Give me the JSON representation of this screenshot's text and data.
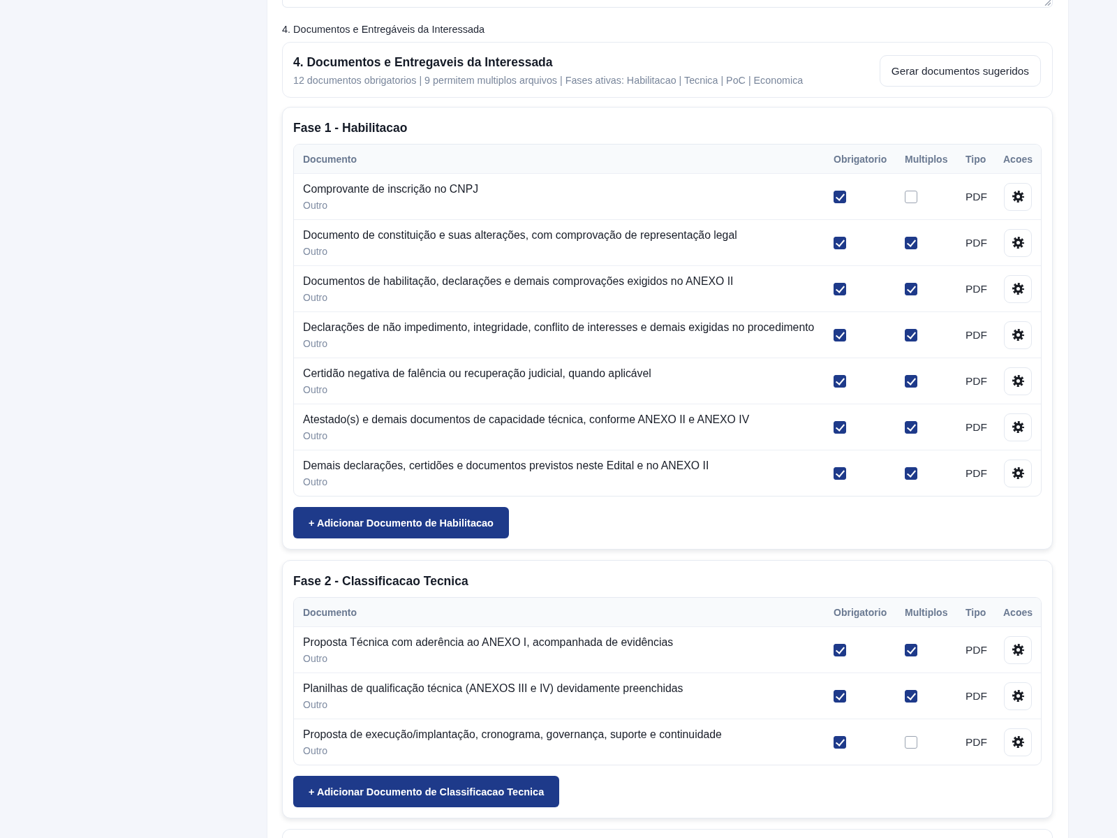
{
  "section_label": "4. Documentos e Entregáveis da Interessada",
  "summary": {
    "title": "4. Documentos e Entregaveis da Interessada",
    "subtitle": "12 documentos obrigatorios | 9 permitem multiplos arquivos | Fases ativas: Habilitacao | Tecnica | PoC | Economica",
    "button": "Gerar documentos sugeridos"
  },
  "phases": [
    {
      "title": "Fase 1 - Habilitacao",
      "columns": [
        "Documento",
        "Obrigatorio",
        "Multiplos",
        "Tipo",
        "Acoes"
      ],
      "rows": [
        {
          "name": "Comprovante de inscrição no CNPJ",
          "category": "Outro",
          "required": true,
          "multiple": false,
          "type": "PDF"
        },
        {
          "name": "Documento de constituição e suas alterações, com comprovação de representação legal",
          "category": "Outro",
          "required": true,
          "multiple": true,
          "type": "PDF"
        },
        {
          "name": "Documentos de habilitação, declarações e demais comprovações exigidos no ANEXO II",
          "category": "Outro",
          "required": true,
          "multiple": true,
          "type": "PDF"
        },
        {
          "name": "Declarações de não impedimento, integridade, conflito de interesses e demais exigidas no procedimento",
          "category": "Outro",
          "required": true,
          "multiple": true,
          "type": "PDF"
        },
        {
          "name": "Certidão negativa de falência ou recuperação judicial, quando aplicável",
          "category": "Outro",
          "required": true,
          "multiple": true,
          "type": "PDF"
        },
        {
          "name": "Atestado(s) e demais documentos de capacidade técnica, conforme ANEXO II e ANEXO IV",
          "category": "Outro",
          "required": true,
          "multiple": true,
          "type": "PDF"
        },
        {
          "name": "Demais declarações, certidões e documentos previstos neste Edital e no ANEXO II",
          "category": "Outro",
          "required": true,
          "multiple": true,
          "type": "PDF"
        }
      ],
      "add_button": "+ Adicionar Documento de Habilitacao"
    },
    {
      "title": "Fase 2 - Classificacao Tecnica",
      "columns": [
        "Documento",
        "Obrigatorio",
        "Multiplos",
        "Tipo",
        "Acoes"
      ],
      "rows": [
        {
          "name": "Proposta Técnica com aderência ao ANEXO I, acompanhada de evidências",
          "category": "Outro",
          "required": true,
          "multiple": true,
          "type": "PDF"
        },
        {
          "name": "Planilhas de qualificação técnica (ANEXOS III e IV) devidamente preenchidas",
          "category": "Outro",
          "required": true,
          "multiple": true,
          "type": "PDF"
        },
        {
          "name": "Proposta de execução/implantação, cronograma, governança, suporte e continuidade",
          "category": "Outro",
          "required": true,
          "multiple": false,
          "type": "PDF"
        }
      ],
      "add_button": "+ Adicionar Documento de Classificacao Tecnica"
    }
  ]
}
